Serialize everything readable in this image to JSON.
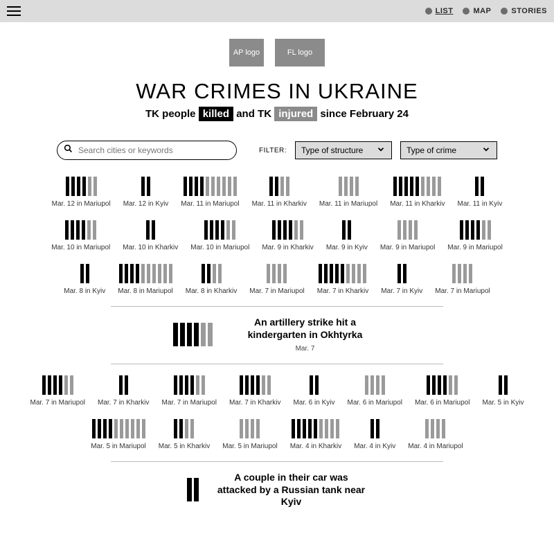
{
  "nav": {
    "items": [
      {
        "label": "LIST",
        "active": true
      },
      {
        "label": "MAP",
        "active": false
      },
      {
        "label": "STORIES",
        "active": false
      }
    ]
  },
  "logos": {
    "one": "AP logo",
    "two": "FL logo"
  },
  "header": {
    "title": "WAR CRIMES IN UKRAINE",
    "sub_prefix": "TK people ",
    "killed_word": "killed",
    "sub_mid": " and TK ",
    "injured_word": "injured",
    "sub_suffix": " since February 24"
  },
  "controls": {
    "search_placeholder": "Search cities or keywords",
    "filter_label": "FILTER:",
    "filter1": "Type of structure",
    "filter2": "Type of crime"
  },
  "events": [
    {
      "label": "Mar. 12 in Mariupol",
      "k": 4,
      "i": 2
    },
    {
      "label": "Mar. 12 in Kyiv",
      "k": 2,
      "i": 0
    },
    {
      "label": "Mar. 11 in Mariupol",
      "k": 4,
      "i": 6
    },
    {
      "label": "Mar. 11 in Kharkiv",
      "k": 2,
      "i": 2
    },
    {
      "label": "Mar. 11 in Mariupol",
      "k": 0,
      "i": 4
    },
    {
      "label": "Mar. 11 in Kharkiv",
      "k": 5,
      "i": 4
    },
    {
      "label": "Mar. 11 in Kyiv",
      "k": 2,
      "i": 0
    },
    {
      "label": "Mar. 10 in Mariupol",
      "k": 4,
      "i": 2
    },
    {
      "label": "Mar. 10 in Kharkiv",
      "k": 2,
      "i": 0
    },
    {
      "label": "Mar. 10 in Mariupol",
      "k": 4,
      "i": 2
    },
    {
      "label": "Mar. 9 in Kharkiv",
      "k": 4,
      "i": 2
    },
    {
      "label": "Mar. 9 in Kyiv",
      "k": 2,
      "i": 0
    },
    {
      "label": "Mar. 9 in Mariupol",
      "k": 0,
      "i": 4
    },
    {
      "label": "Mar. 9 in Mariupol",
      "k": 4,
      "i": 2
    },
    {
      "label": "Mar. 8 in Kyiv",
      "k": 2,
      "i": 0
    },
    {
      "label": "Mar. 8 in Mariupol",
      "k": 4,
      "i": 6
    },
    {
      "label": "Mar. 8 in Kharkiv",
      "k": 2,
      "i": 2
    },
    {
      "label": "Mar. 7 in Mariupol",
      "k": 0,
      "i": 4
    },
    {
      "label": "Mar. 7 in Kharkiv",
      "k": 5,
      "i": 4
    },
    {
      "label": "Mar. 7 in Kyiv",
      "k": 2,
      "i": 0
    },
    {
      "label": "Mar. 7 in Mariupol",
      "k": 0,
      "i": 4
    }
  ],
  "feature1": {
    "title": "An artillery strike hit a kindergarten in Okhtyrka",
    "date": "Mar. 7",
    "k": 4,
    "i": 2
  },
  "events2": [
    {
      "label": "Mar. 7 in Mariupol",
      "k": 4,
      "i": 2
    },
    {
      "label": "Mar. 7 in Kharkiv",
      "k": 2,
      "i": 0
    },
    {
      "label": "Mar. 7 in Mariupol",
      "k": 4,
      "i": 2
    },
    {
      "label": "Mar. 7 in Kharkiv",
      "k": 4,
      "i": 2
    },
    {
      "label": "Mar. 6 in Kyiv",
      "k": 2,
      "i": 0
    },
    {
      "label": "Mar. 6 in Mariupol",
      "k": 0,
      "i": 4
    },
    {
      "label": "Mar. 6 in Mariupol",
      "k": 4,
      "i": 2
    },
    {
      "label": "Mar. 5 in Kyiv",
      "k": 2,
      "i": 0
    },
    {
      "label": "Mar. 5 in Mariupol",
      "k": 4,
      "i": 6
    },
    {
      "label": "Mar. 5 in Kharkiv",
      "k": 2,
      "i": 2
    },
    {
      "label": "Mar. 5 in Mariupol",
      "k": 0,
      "i": 4
    },
    {
      "label": "Mar. 4 in Kharkiv",
      "k": 5,
      "i": 4
    },
    {
      "label": "Mar. 4 in Kyiv",
      "k": 2,
      "i": 0
    },
    {
      "label": "Mar. 4 in Mariupol",
      "k": 0,
      "i": 4
    }
  ],
  "feature2": {
    "title": "A couple in their car was attacked by a Russian tank near Kyiv",
    "date": "",
    "k": 2,
    "i": 0
  }
}
